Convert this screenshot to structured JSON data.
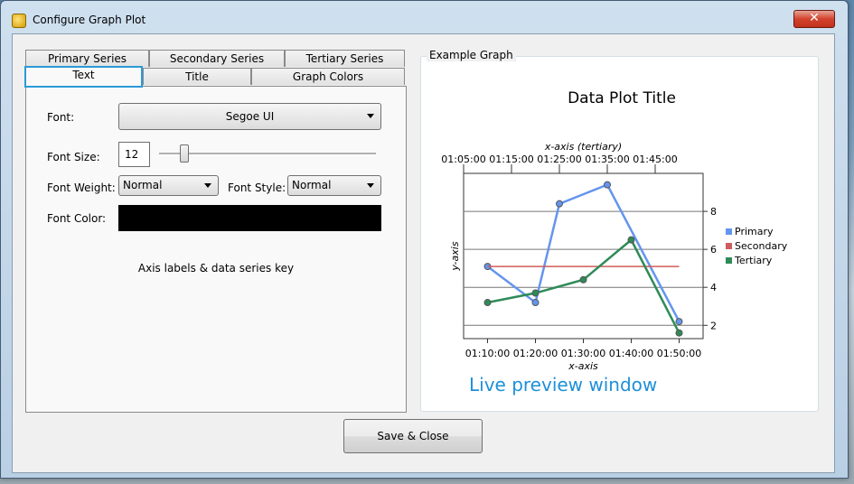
{
  "window": {
    "title": "Configure Graph Plot",
    "close_glyph": "✕",
    "icon": "app-icon"
  },
  "tabs": {
    "row1": [
      "Primary Series",
      "Secondary Series",
      "Tertiary Series"
    ],
    "row2": [
      "Text",
      "Title",
      "Graph Colors"
    ],
    "active": "Text"
  },
  "text_tab": {
    "font_label": "Font:",
    "font_value": "Segoe UI",
    "font_size_label": "Font Size:",
    "font_size_value": "12",
    "font_size_slider_fraction": 0.1,
    "font_weight_label": "Font Weight:",
    "font_weight_value": "Normal",
    "font_style_label": "Font Style:",
    "font_style_value": "Normal",
    "font_color_label": "Font Color:",
    "font_color_value": "#000000",
    "description": "Axis labels & data series key"
  },
  "example": {
    "group_title": "Example Graph",
    "caption": "Live preview window",
    "caption_color": "#1e90d8"
  },
  "buttons": {
    "save_close": "Save & Close"
  },
  "chart_data": {
    "type": "line",
    "title": "Data Plot Title",
    "xlabel": "x-axis",
    "ylabel": "y-axis",
    "x2label": "x-axis (tertiary)",
    "x_ticks": [
      "01:10:00",
      "01:20:00",
      "01:30:00",
      "01:40:00",
      "01:50:00"
    ],
    "x2_ticks": [
      "01:05:00",
      "01:15:00",
      "01:25:00",
      "01:35:00",
      "01:45:00"
    ],
    "y_ticks": [
      2,
      4,
      6,
      8
    ],
    "ylim": [
      1.3,
      10
    ],
    "x_minutes_range": [
      65,
      115
    ],
    "grid": true,
    "legend_position": "right",
    "series": [
      {
        "name": "Primary",
        "color": "#6495ed",
        "x": [
          "01:10:00",
          "01:20:00",
          "01:25:00",
          "01:35:00",
          "01:50:00"
        ],
        "y": [
          5.1,
          3.2,
          8.4,
          9.4,
          2.2
        ]
      },
      {
        "name": "Secondary",
        "color": "#cd5c5c",
        "x": [
          "01:10:00",
          "01:50:00"
        ],
        "y": [
          5.1,
          5.1
        ]
      },
      {
        "name": "Tertiary",
        "color": "#2e8b57",
        "x": [
          "01:10:00",
          "01:20:00",
          "01:30:00",
          "01:40:00",
          "01:50:00"
        ],
        "y": [
          3.2,
          3.7,
          4.4,
          6.5,
          1.6
        ]
      }
    ]
  }
}
